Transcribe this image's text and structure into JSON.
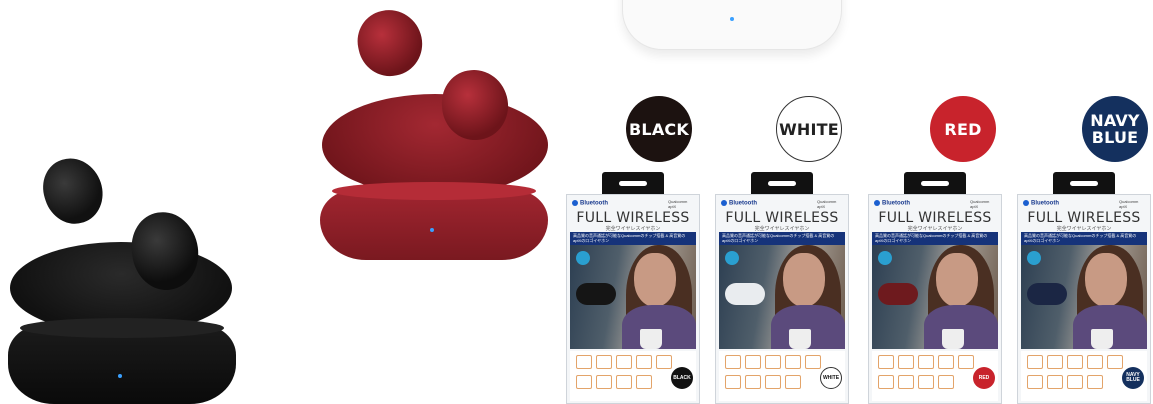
{
  "swatches": [
    {
      "label": "BLACK",
      "bg": "#1c1210",
      "fg": "#ffffff",
      "border": "#1c1210"
    },
    {
      "label": "WHITE",
      "bg": "#ffffff",
      "fg": "#222222",
      "border": "#333333"
    },
    {
      "label": "RED",
      "bg": "#c8232c",
      "fg": "#ffffff",
      "border": "#c8232c"
    },
    {
      "label": "NAVY\nBLUE",
      "bg": "#14305e",
      "fg": "#ffffff",
      "border": "#14305e"
    }
  ],
  "packages": [
    {
      "brand": "Bluetooth",
      "qualcomm": "Qualcomm aptX",
      "title": "FULL WIRELESS",
      "subtitle": "完全ワイヤレスイヤホン",
      "strip": "高品質の音声通話が可能なQualcommのチップ搭載 & 高音質のaptXのロゴイヤホン",
      "tag": "BLACK",
      "case_color": "#151515",
      "tag_bg": "#111111",
      "tag_fg": "#ffffff"
    },
    {
      "brand": "Bluetooth",
      "qualcomm": "Qualcomm aptX",
      "title": "FULL WIRELESS",
      "subtitle": "完全ワイヤレスイヤホン",
      "strip": "高品質の音声通話が可能なQualcommのチップ搭載 & 高音質のaptXのロゴイヤホン",
      "tag": "WHITE",
      "case_color": "#e9ecef",
      "tag_bg": "#ffffff",
      "tag_fg": "#111111"
    },
    {
      "brand": "Bluetooth",
      "qualcomm": "Qualcomm aptX",
      "title": "FULL WIRELESS",
      "subtitle": "完全ワイヤレスイヤホン",
      "strip": "高品質の音声通話が可能なQualcommのチップ搭載 & 高音質のaptXのロゴイヤホン",
      "tag": "RED",
      "case_color": "#6e1a1e",
      "tag_bg": "#c8232c",
      "tag_fg": "#ffffff"
    },
    {
      "brand": "Bluetooth",
      "qualcomm": "Qualcomm aptX",
      "title": "FULL WIRELESS",
      "subtitle": "完全ワイヤレスイヤホン",
      "strip": "高品質の音声通話が可能なQualcommのチップ搭載 & 高音質のaptXのロゴイヤホン",
      "tag": "NAVY BLUE",
      "case_color": "#1b2644",
      "tag_bg": "#14305e",
      "tag_fg": "#ffffff"
    }
  ],
  "colors": {
    "black_case": "#111111",
    "red_case": "#8f1d24",
    "white_case": "#f5f5f5",
    "led": "#3aa0ff"
  }
}
